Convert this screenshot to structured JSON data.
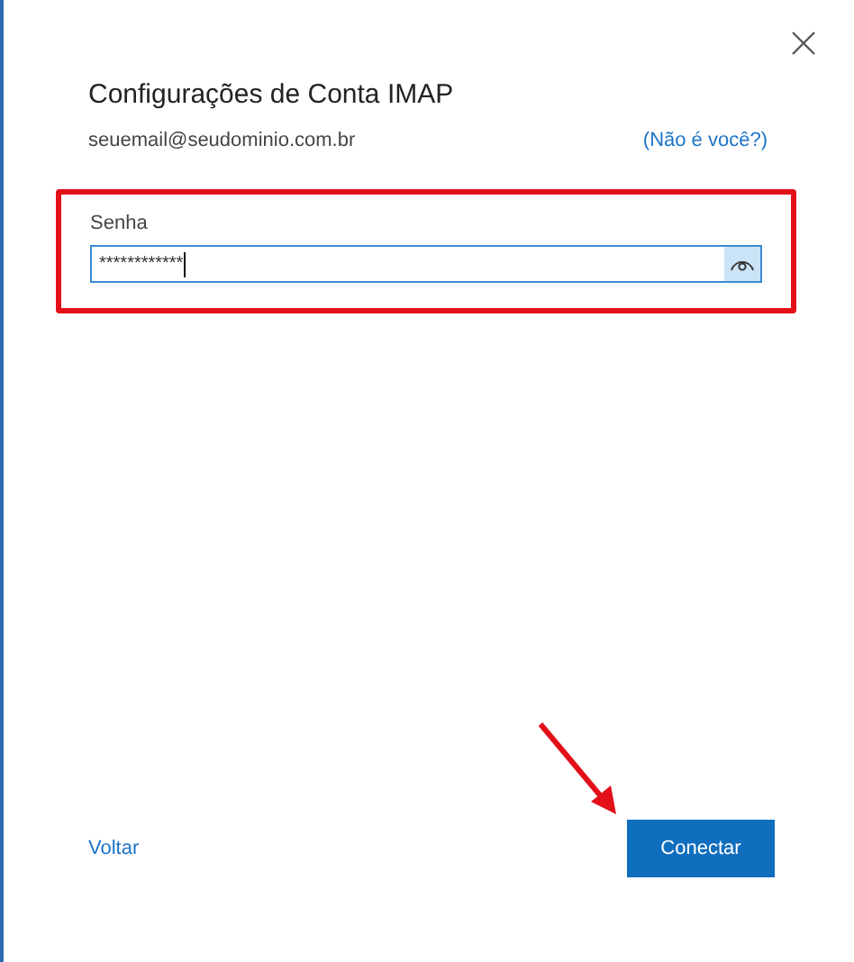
{
  "dialog": {
    "title": "Configurações de Conta IMAP",
    "email": "seuemail@seudominio.com.br",
    "not_you_link": "(Não é você?)"
  },
  "password": {
    "label": "Senha",
    "value": "************",
    "focused": true
  },
  "buttons": {
    "back": "Voltar",
    "connect": "Conectar"
  }
}
